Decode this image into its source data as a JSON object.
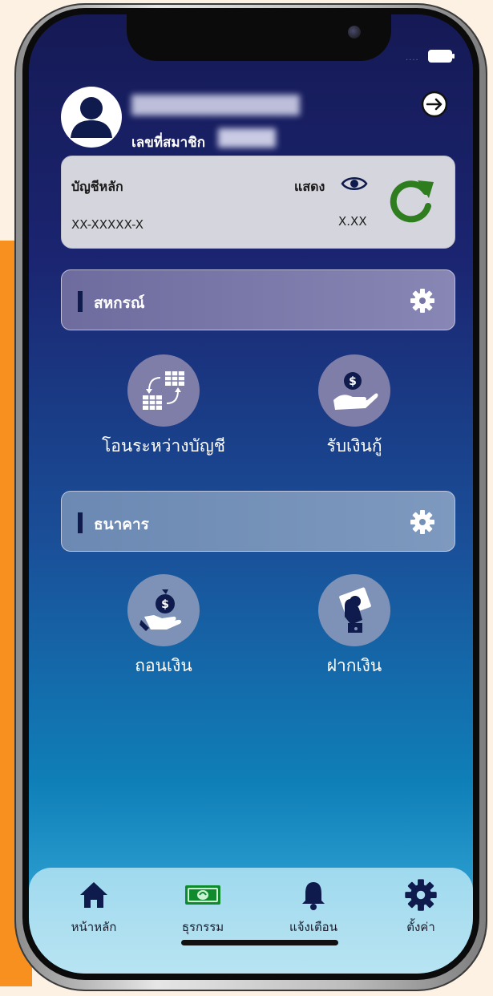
{
  "header": {
    "member_label": "เลขที่สมาชิก"
  },
  "account": {
    "title": "บัญชีหลัก",
    "show_label": "แสดง",
    "account_number": "XX-XXXXX-X",
    "balance": "X.XX"
  },
  "sections": {
    "coop": {
      "title": "สหกรณ์",
      "items": [
        {
          "label": "โอนระหว่างบัญชี",
          "icon": "transfer-icon"
        },
        {
          "label": "รับเงินกู้",
          "icon": "receive-loan-icon"
        }
      ]
    },
    "bank": {
      "title": "ธนาคาร",
      "items": [
        {
          "label": "ถอนเงิน",
          "icon": "withdraw-icon"
        },
        {
          "label": "ฝากเงิน",
          "icon": "deposit-icon"
        }
      ]
    }
  },
  "bottom_nav": [
    {
      "label": "หน้าหลัก",
      "icon": "home-icon"
    },
    {
      "label": "ธุรกรรม",
      "icon": "money-icon"
    },
    {
      "label": "แจ้งเตือน",
      "icon": "bell-icon"
    },
    {
      "label": "ตั้งค่า",
      "icon": "gear-icon"
    }
  ],
  "colors": {
    "refresh": "#2e7d1f",
    "navy": "#0f1a4d",
    "section_coop": "#7775a8",
    "section_bank": "#7490b8"
  }
}
